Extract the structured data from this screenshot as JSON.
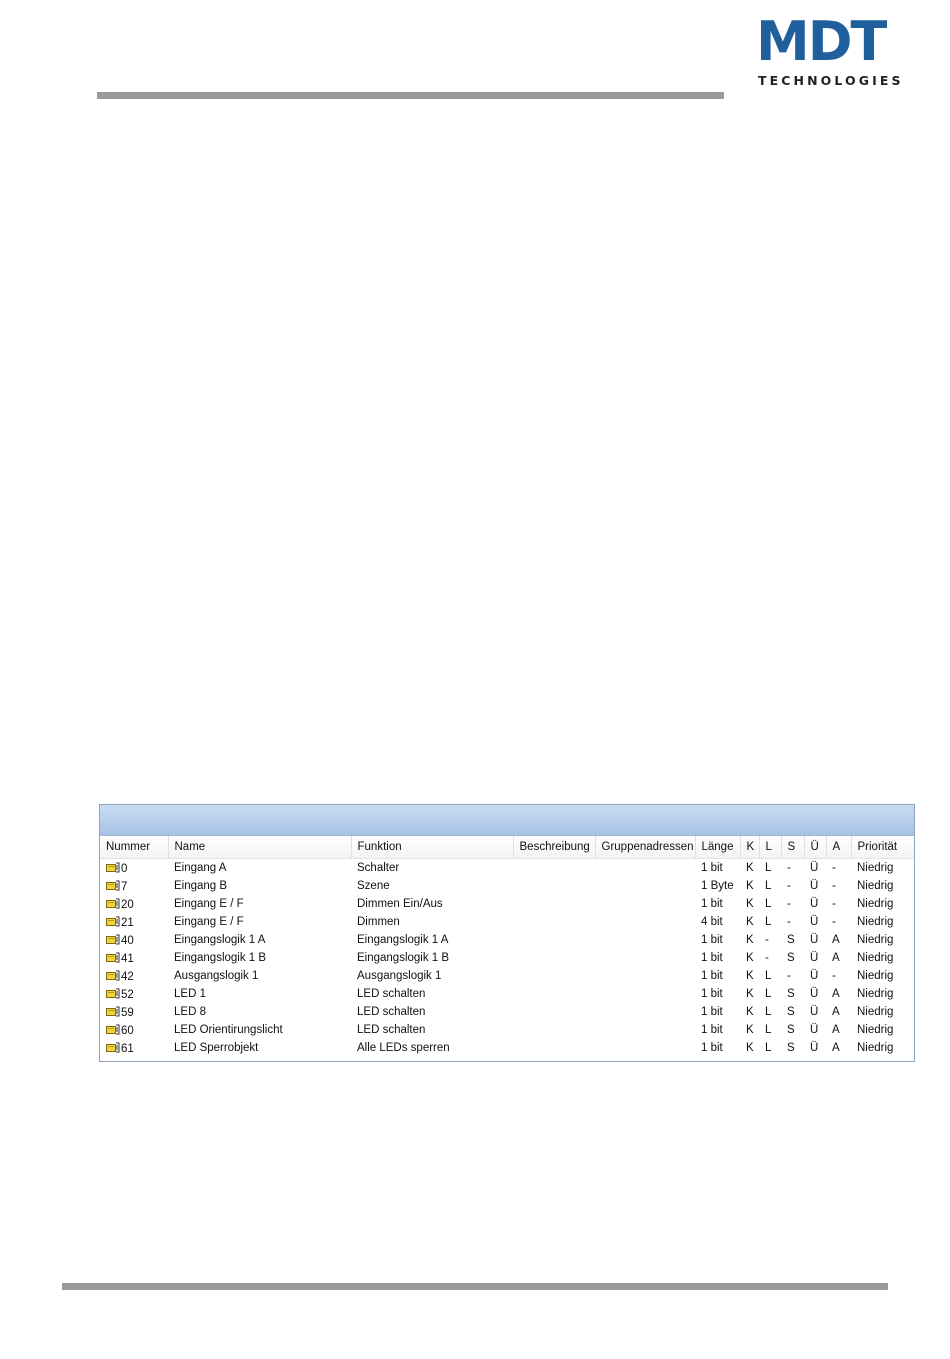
{
  "header": {
    "logo_main": "MDT",
    "logo_sub": "TECHNOLOGIES"
  },
  "table": {
    "columns": [
      "Nummer",
      "Name",
      "Funktion",
      "Beschreibung",
      "Gruppenadressen",
      "Länge",
      "K",
      "L",
      "S",
      "Ü",
      "A",
      "Priorität"
    ],
    "rows": [
      {
        "nummer": "0",
        "name": "Eingang A",
        "funktion": "Schalter",
        "beschreibung": "",
        "gruppenadressen": "",
        "laenge": "1 bit",
        "k": "K",
        "l": "L",
        "s": "-",
        "u": "Ü",
        "a": "-",
        "prioritaet": "Niedrig"
      },
      {
        "nummer": "7",
        "name": "Eingang B",
        "funktion": "Szene",
        "beschreibung": "",
        "gruppenadressen": "",
        "laenge": "1 Byte",
        "k": "K",
        "l": "L",
        "s": "-",
        "u": "Ü",
        "a": "-",
        "prioritaet": "Niedrig"
      },
      {
        "nummer": "20",
        "name": "Eingang E / F",
        "funktion": "Dimmen Ein/Aus",
        "beschreibung": "",
        "gruppenadressen": "",
        "laenge": "1 bit",
        "k": "K",
        "l": "L",
        "s": "-",
        "u": "Ü",
        "a": "-",
        "prioritaet": "Niedrig"
      },
      {
        "nummer": "21",
        "name": "Eingang E / F",
        "funktion": "Dimmen",
        "beschreibung": "",
        "gruppenadressen": "",
        "laenge": "4 bit",
        "k": "K",
        "l": "L",
        "s": "-",
        "u": "Ü",
        "a": "-",
        "prioritaet": "Niedrig"
      },
      {
        "nummer": "40",
        "name": "Eingangslogik 1 A",
        "funktion": "Eingangslogik 1 A",
        "beschreibung": "",
        "gruppenadressen": "",
        "laenge": "1 bit",
        "k": "K",
        "l": "-",
        "s": "S",
        "u": "Ü",
        "a": "A",
        "prioritaet": "Niedrig"
      },
      {
        "nummer": "41",
        "name": "Eingangslogik 1 B",
        "funktion": "Eingangslogik 1 B",
        "beschreibung": "",
        "gruppenadressen": "",
        "laenge": "1 bit",
        "k": "K",
        "l": "-",
        "s": "S",
        "u": "Ü",
        "a": "A",
        "prioritaet": "Niedrig"
      },
      {
        "nummer": "42",
        "name": "Ausgangslogik 1",
        "funktion": "Ausgangslogik 1",
        "beschreibung": "",
        "gruppenadressen": "",
        "laenge": "1 bit",
        "k": "K",
        "l": "L",
        "s": "-",
        "u": "Ü",
        "a": "-",
        "prioritaet": "Niedrig"
      },
      {
        "nummer": "52",
        "name": "LED 1",
        "funktion": "LED schalten",
        "beschreibung": "",
        "gruppenadressen": "",
        "laenge": "1 bit",
        "k": "K",
        "l": "L",
        "s": "S",
        "u": "Ü",
        "a": "A",
        "prioritaet": "Niedrig"
      },
      {
        "nummer": "59",
        "name": "LED 8",
        "funktion": "LED schalten",
        "beschreibung": "",
        "gruppenadressen": "",
        "laenge": "1 bit",
        "k": "K",
        "l": "L",
        "s": "S",
        "u": "Ü",
        "a": "A",
        "prioritaet": "Niedrig"
      },
      {
        "nummer": "60",
        "name": "LED Orientirungslicht",
        "funktion": "LED schalten",
        "beschreibung": "",
        "gruppenadressen": "",
        "laenge": "1 bit",
        "k": "K",
        "l": "L",
        "s": "S",
        "u": "Ü",
        "a": "A",
        "prioritaet": "Niedrig"
      },
      {
        "nummer": "61",
        "name": "LED Sperrobjekt",
        "funktion": "Alle LEDs sperren",
        "beschreibung": "",
        "gruppenadressen": "",
        "laenge": "1 bit",
        "k": "K",
        "l": "L",
        "s": "S",
        "u": "Ü",
        "a": "A",
        "prioritaet": "Niedrig"
      }
    ]
  },
  "colors": {
    "brand_blue": "#1f5f9c",
    "rule_gray": "#9a9a9a",
    "panel_bar": "#b8cfea"
  },
  "icons": {
    "object_icon": "communication-object-icon"
  }
}
